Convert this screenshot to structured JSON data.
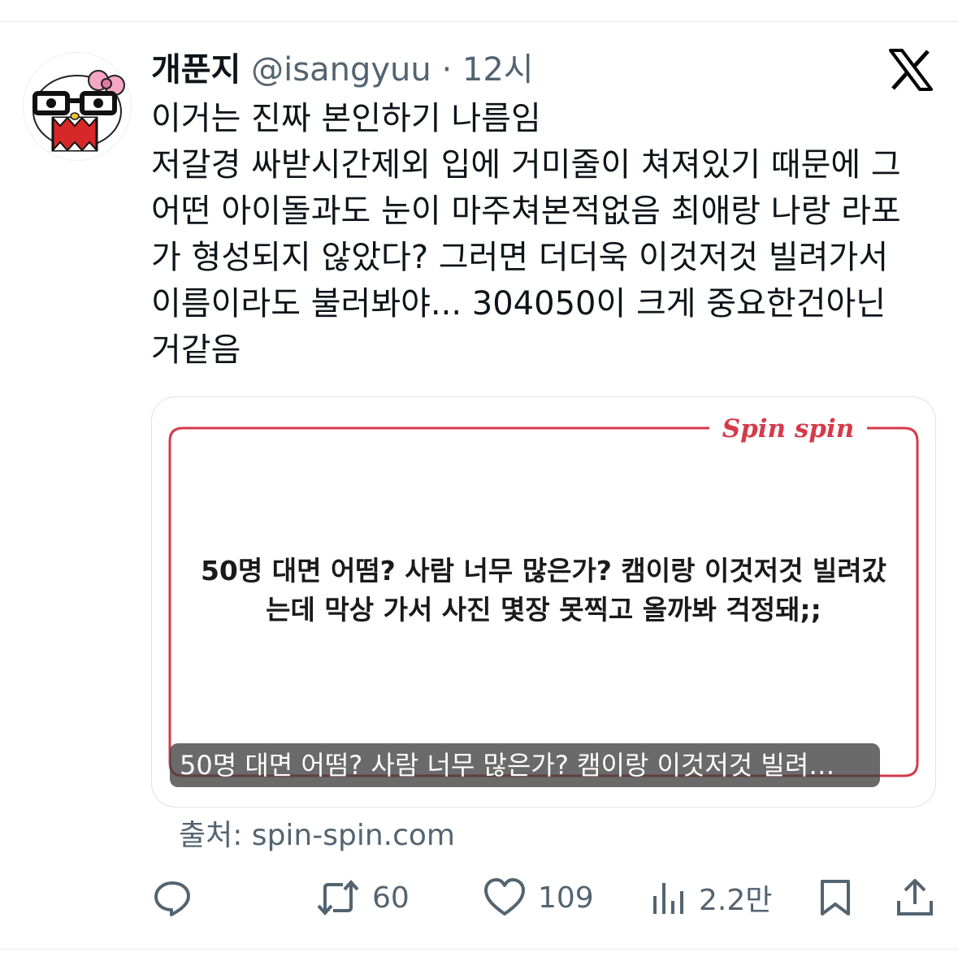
{
  "tweet": {
    "display_name": "개푼지",
    "handle": "@isangyuu",
    "separator": "·",
    "time": "12시",
    "lines": [
      "이거는 진짜 본인하기 나름임",
      "저갈경 싸받시간제외 입에 거미줄이 쳐져있기 때문에 그",
      "어떤 아이돌과도 눈이 마주쳐본적없음 최애랑 나랑 라포",
      "가 형성되지 않았다? 그러면 더더욱 이것저것 빌려가서",
      "이름이라도 불러봐야... 304050이 크게 중요한건아닌",
      "거같음"
    ]
  },
  "card": {
    "brand": "Spin spin",
    "body_lines": [
      "50명 대면 어떰? 사람 너무 많은가? 캠이랑 이것저것 빌려갔",
      "는데 막상 가서 사진 몇장 못찍고 올까봐 걱정돼;;"
    ],
    "caption": "50명 대면 어떰? 사람 너무 많은가? 캠이랑 이것저것 빌려…",
    "accent_color": "#d63a4a"
  },
  "source": "출처: spin-spin.com",
  "actions": {
    "reply_icon": "reply-icon",
    "retweets": "60",
    "likes": "109",
    "views": "2.2만"
  },
  "colors": {
    "text": "#0f1419",
    "muted": "#536471"
  }
}
